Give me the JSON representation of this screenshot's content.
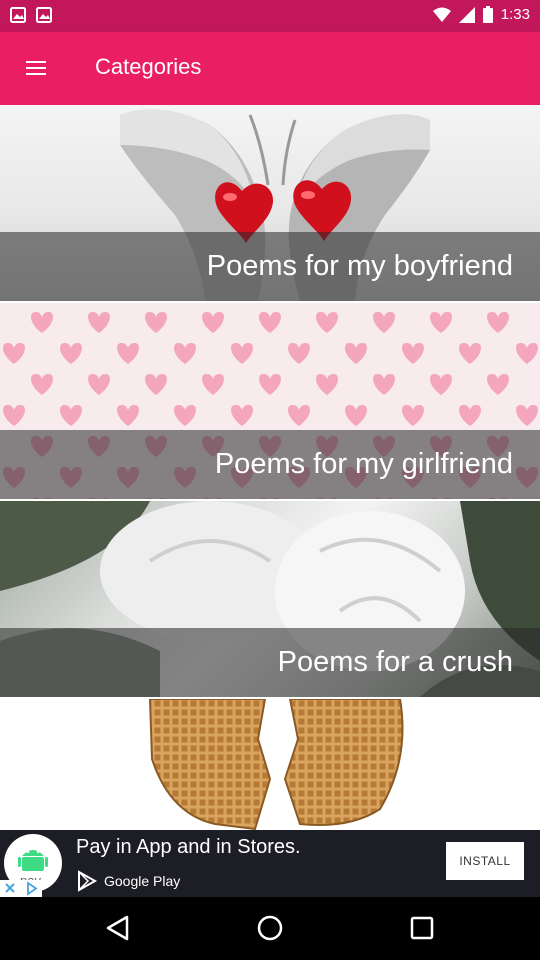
{
  "status_bar": {
    "time": "1:33",
    "icons": [
      "gallery-icon",
      "gallery-icon",
      "wifi-icon",
      "signal-icon",
      "battery-icon"
    ]
  },
  "app_bar": {
    "title": "Categories",
    "menu_icon": "hamburger-menu-icon"
  },
  "categories": [
    {
      "label": "Poems for my boyfriend",
      "image": "hands-with-hearts"
    },
    {
      "label": "Poems for my girlfriend",
      "image": "pink-hearts-pattern"
    },
    {
      "label": "Poems for a crush",
      "image": "white-roses"
    },
    {
      "label": "",
      "image": "broken-waffle-heart"
    }
  ],
  "ad": {
    "title": "Pay in App and in Stores.",
    "store_label": "Google Play",
    "install_label": "INSTALL",
    "logo_text": "pay",
    "colors": {
      "background": "#1d1d26",
      "logo_green": "#3ddc84"
    }
  },
  "nav_bar": {
    "buttons": [
      "back-icon",
      "home-icon",
      "recents-icon"
    ]
  },
  "colors": {
    "status_bar": "#c2185b",
    "app_bar": "#e91e63",
    "heart_red": "#d0101c",
    "heart_pink": "#f4a6be"
  }
}
